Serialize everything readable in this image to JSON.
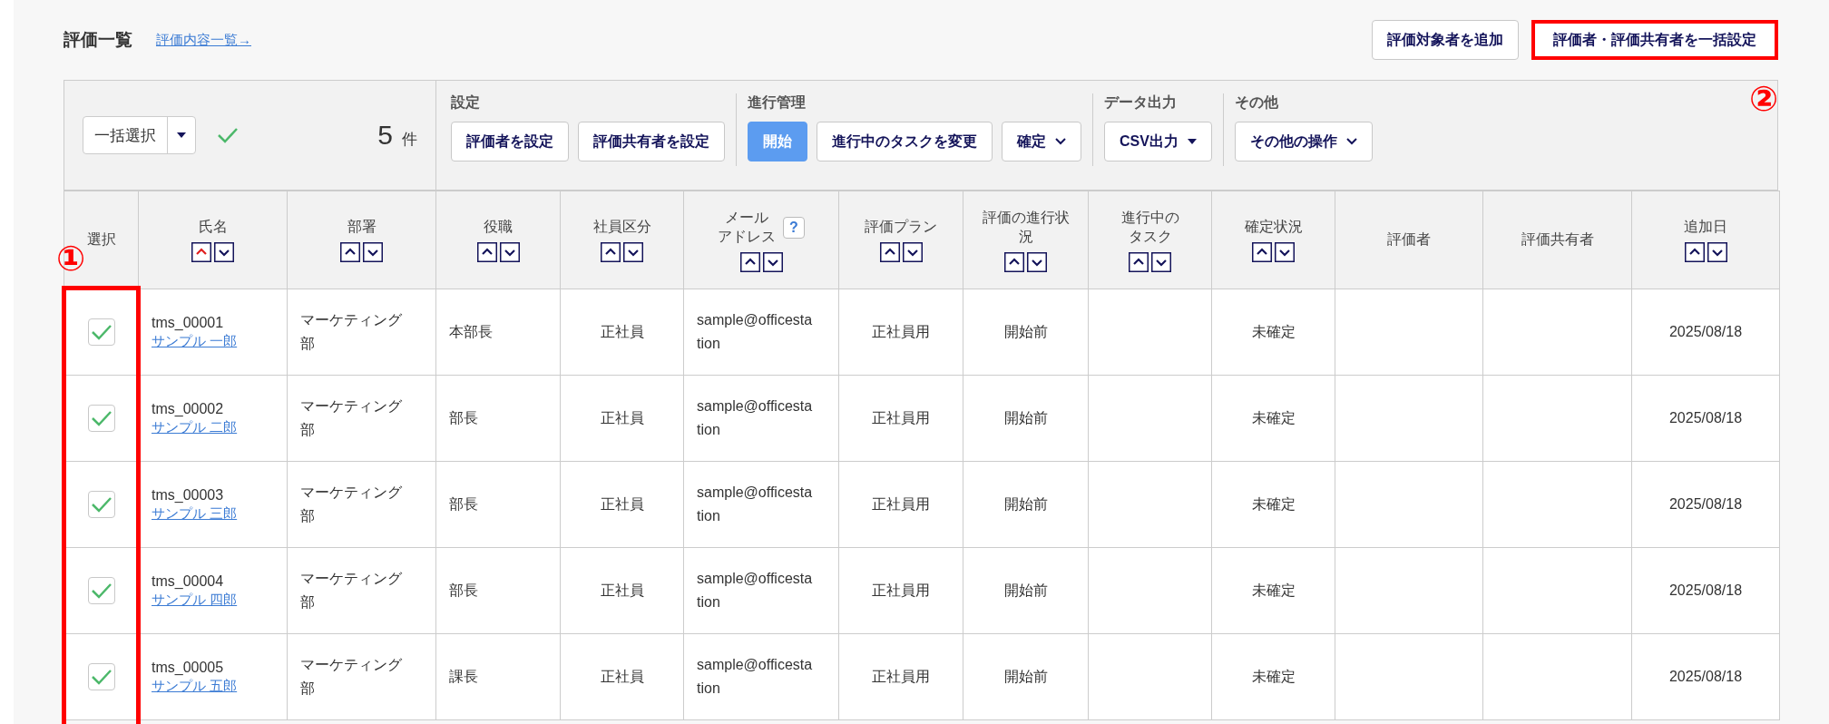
{
  "page": {
    "title": "評価一覧",
    "link": "評価内容一覧→"
  },
  "header_buttons": [
    {
      "label": "評価対象者を追加",
      "highlighted": false
    },
    {
      "label": "評価者・評価共有者を一括設定",
      "highlighted": true
    }
  ],
  "toolbar": {
    "bulk_select": "一括選択",
    "count": "5",
    "count_unit": "件",
    "groups": [
      {
        "title": "設定",
        "buttons": [
          {
            "label": "評価者を設定",
            "primary": false,
            "kind": "plain"
          },
          {
            "label": "評価共有者を設定",
            "primary": false,
            "kind": "plain"
          }
        ]
      },
      {
        "title": "進行管理",
        "buttons": [
          {
            "label": "開始",
            "primary": true,
            "kind": "plain"
          },
          {
            "label": "進行中のタスクを変更",
            "primary": false,
            "kind": "plain"
          },
          {
            "label": "確定",
            "primary": false,
            "kind": "menu"
          }
        ]
      },
      {
        "title": "データ出力",
        "buttons": [
          {
            "label": "CSV出力",
            "primary": false,
            "kind": "dropdown"
          }
        ]
      },
      {
        "title": "その他",
        "buttons": [
          {
            "label": "その他の操作",
            "primary": false,
            "kind": "menu"
          }
        ]
      }
    ]
  },
  "table": {
    "columns": [
      {
        "lines": [
          "選択"
        ],
        "sortable": false
      },
      {
        "lines": [
          "氏名"
        ],
        "sortable": true,
        "sorted_ascending": true
      },
      {
        "lines": [
          "部署"
        ],
        "sortable": true,
        "sorted_ascending": false
      },
      {
        "lines": [
          "役職"
        ],
        "sortable": true,
        "sorted_ascending": false
      },
      {
        "lines": [
          "社員区分"
        ],
        "sortable": true,
        "sorted_ascending": false
      },
      {
        "lines": [
          "メール",
          "アドレス"
        ],
        "sortable": true,
        "sorted_ascending": false,
        "help": "?"
      },
      {
        "lines": [
          "評価プラン"
        ],
        "sortable": true,
        "sorted_ascending": false
      },
      {
        "lines": [
          "評価の進行状",
          "況"
        ],
        "sortable": true,
        "sorted_ascending": false
      },
      {
        "lines": [
          "進行中の",
          "タスク"
        ],
        "sortable": true,
        "sorted_ascending": false
      },
      {
        "lines": [
          "確定状況"
        ],
        "sortable": true,
        "sorted_ascending": false
      },
      {
        "lines": [
          "評価者"
        ],
        "sortable": false
      },
      {
        "lines": [
          "評価共有者"
        ],
        "sortable": false
      },
      {
        "lines": [
          "追加日"
        ],
        "sortable": true,
        "sorted_ascending": false
      }
    ],
    "rows": [
      {
        "checked": true,
        "id": "tms_00001",
        "name": "サンプル 一郎",
        "department": "マーケティング部",
        "position": "本部長",
        "employment": "正社員",
        "email": "sample@officestation",
        "plan": "正社員用",
        "progress": "開始前",
        "confirmation": "未確定",
        "added": "2025/08/18"
      },
      {
        "checked": true,
        "id": "tms_00002",
        "name": "サンプル 二郎",
        "department": "マーケティング部",
        "position": "部長",
        "employment": "正社員",
        "email": "sample@officestation",
        "plan": "正社員用",
        "progress": "開始前",
        "confirmation": "未確定",
        "added": "2025/08/18"
      },
      {
        "checked": true,
        "id": "tms_00003",
        "name": "サンプル 三郎",
        "department": "マーケティング部",
        "position": "部長",
        "employment": "正社員",
        "email": "sample@officestation",
        "plan": "正社員用",
        "progress": "開始前",
        "confirmation": "未確定",
        "added": "2025/08/18"
      },
      {
        "checked": true,
        "id": "tms_00004",
        "name": "サンプル 四郎",
        "department": "マーケティング部",
        "position": "部長",
        "employment": "正社員",
        "email": "sample@officestation",
        "plan": "正社員用",
        "progress": "開始前",
        "confirmation": "未確定",
        "added": "2025/08/18"
      },
      {
        "checked": true,
        "id": "tms_00005",
        "name": "サンプル 五郎",
        "department": "マーケティング部",
        "position": "課長",
        "employment": "正社員",
        "email": "sample@officestation",
        "plan": "正社員用",
        "progress": "開始前",
        "confirmation": "未確定",
        "added": "2025/08/18"
      }
    ]
  },
  "annotations": [
    {
      "label": "①"
    },
    {
      "label": "②"
    }
  ]
}
